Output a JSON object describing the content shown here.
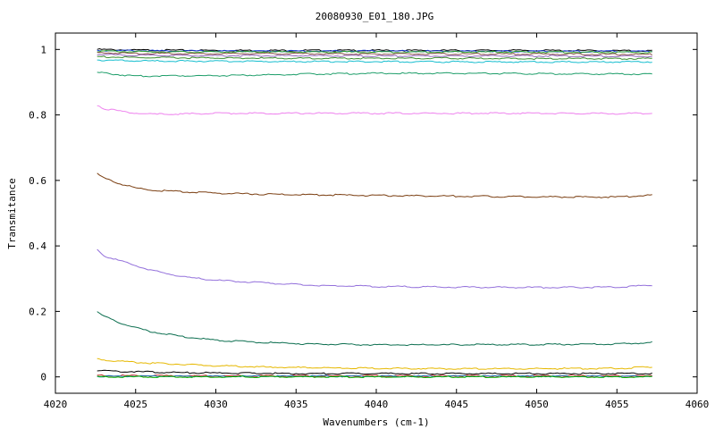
{
  "chart_data": {
    "type": "line",
    "title": "20080930_E01_180.JPG",
    "xlabel": "Wavenumbers (cm-1)",
    "ylabel": "Transmitance",
    "xlim": [
      4020,
      4060
    ],
    "ylim": [
      -0.05,
      1.05
    ],
    "x_ticks": [
      4020,
      4025,
      4030,
      4035,
      4040,
      4045,
      4050,
      4055,
      4060
    ],
    "x_tick_labels": [
      "4020",
      "4025",
      "4030",
      "4035",
      "4040",
      "4045",
      "4050",
      "4055",
      "4060"
    ],
    "y_ticks": [
      0,
      0.2,
      0.4,
      0.6,
      0.8,
      1
    ],
    "y_tick_labels": [
      "0",
      "0.2",
      "0.4",
      "0.6",
      "0.8",
      "1"
    ],
    "grid": false,
    "legend": "none",
    "x_range_of_data": [
      4022.6,
      4057.2
    ],
    "series": [
      {
        "color": "#000000",
        "x": [
          4022.6,
          4025,
          4030,
          4035,
          4040,
          4045,
          4050,
          4055,
          4057.2
        ],
        "y": [
          1.0,
          0.998,
          0.997,
          0.997,
          0.997,
          0.997,
          0.997,
          0.996,
          0.996
        ]
      },
      {
        "color": "#1a3fd6",
        "x": [
          4022.6,
          4025,
          4030,
          4035,
          4040,
          4045,
          4050,
          4055,
          4057.2
        ],
        "y": [
          0.997,
          0.996,
          0.995,
          0.995,
          0.995,
          0.995,
          0.994,
          0.994,
          0.994
        ]
      },
      {
        "color": "#2ca02c",
        "x": [
          4022.6,
          4025,
          4030,
          4035,
          4040,
          4045,
          4050,
          4055,
          4057.2
        ],
        "y": [
          0.995,
          0.993,
          0.992,
          0.992,
          0.992,
          0.992,
          0.992,
          0.991,
          0.991
        ]
      },
      {
        "color": "#8c564b",
        "x": [
          4022.6,
          4025,
          4030,
          4035,
          4040,
          4045,
          4050,
          4055,
          4057.2
        ],
        "y": [
          0.99,
          0.988,
          0.987,
          0.987,
          0.986,
          0.986,
          0.986,
          0.985,
          0.985
        ]
      },
      {
        "color": "#9467bd",
        "x": [
          4022.6,
          4025,
          4030,
          4035,
          4040,
          4045,
          4050,
          4055,
          4057.2
        ],
        "y": [
          0.985,
          0.982,
          0.981,
          0.981,
          0.98,
          0.98,
          0.98,
          0.979,
          0.979
        ]
      },
      {
        "color": "#3d8f2f",
        "x": [
          4022.6,
          4025,
          4030,
          4035,
          4040,
          4045,
          4050,
          4055,
          4057.2
        ],
        "y": [
          0.978,
          0.975,
          0.974,
          0.973,
          0.973,
          0.973,
          0.972,
          0.972,
          0.972
        ]
      },
      {
        "color": "#17becf",
        "x": [
          4022.6,
          4025,
          4030,
          4035,
          4040,
          4045,
          4050,
          4055,
          4057.2
        ],
        "y": [
          0.968,
          0.965,
          0.964,
          0.963,
          0.963,
          0.962,
          0.962,
          0.962,
          0.962
        ]
      },
      {
        "color": "#1e9e6a",
        "x": [
          4022.6,
          4023.5,
          4025,
          4027,
          4030,
          4033,
          4036,
          4040,
          4045,
          4050,
          4055,
          4057.2
        ],
        "y": [
          0.93,
          0.925,
          0.918,
          0.92,
          0.92,
          0.922,
          0.925,
          0.927,
          0.927,
          0.926,
          0.925,
          0.925
        ]
      },
      {
        "color": "#ee82ee",
        "x": [
          4022.6,
          4023,
          4024,
          4025,
          4026,
          4028,
          4030,
          4033,
          4036,
          4040,
          4045,
          4050,
          4055,
          4057.2
        ],
        "y": [
          0.83,
          0.82,
          0.812,
          0.805,
          0.802,
          0.803,
          0.805,
          0.805,
          0.805,
          0.805,
          0.805,
          0.805,
          0.804,
          0.805
        ]
      },
      {
        "color": "#7b3f12",
        "x": [
          4022.6,
          4023,
          4024,
          4025,
          4026,
          4028,
          4030,
          4033,
          4036,
          4040,
          4045,
          4050,
          4055,
          4057.2
        ],
        "y": [
          0.62,
          0.608,
          0.59,
          0.577,
          0.57,
          0.565,
          0.561,
          0.558,
          0.556,
          0.554,
          0.552,
          0.55,
          0.549,
          0.555
        ]
      },
      {
        "color": "#9370db",
        "x": [
          4022.6,
          4023,
          4024,
          4025,
          4026,
          4028,
          4030,
          4033,
          4036,
          4040,
          4045,
          4050,
          4055,
          4057.2
        ],
        "y": [
          0.39,
          0.37,
          0.355,
          0.34,
          0.325,
          0.305,
          0.295,
          0.287,
          0.28,
          0.276,
          0.274,
          0.273,
          0.274,
          0.28
        ]
      },
      {
        "color": "#0b6e4f",
        "x": [
          4022.6,
          4023,
          4024,
          4025,
          4026,
          4028,
          4030,
          4033,
          4036,
          4040,
          4045,
          4050,
          4055,
          4057.2
        ],
        "y": [
          0.2,
          0.185,
          0.165,
          0.15,
          0.138,
          0.122,
          0.112,
          0.105,
          0.1,
          0.098,
          0.098,
          0.099,
          0.1,
          0.105
        ]
      },
      {
        "color": "#e6b800",
        "x": [
          4022.6,
          4023,
          4024,
          4025,
          4026,
          4028,
          4030,
          4033,
          4036,
          4040,
          4045,
          4050,
          4055,
          4057.2
        ],
        "y": [
          0.055,
          0.052,
          0.048,
          0.045,
          0.042,
          0.038,
          0.034,
          0.03,
          0.028,
          0.026,
          0.025,
          0.025,
          0.026,
          0.03
        ]
      },
      {
        "color": "#000000",
        "x": [
          4022.6,
          4024,
          4026,
          4028,
          4030,
          4033,
          4036,
          4040,
          4045,
          4050,
          4055,
          4057.2
        ],
        "y": [
          0.02,
          0.017,
          0.015,
          0.013,
          0.012,
          0.011,
          0.01,
          0.01,
          0.01,
          0.01,
          0.01,
          0.01
        ]
      },
      {
        "color": "#cc3333",
        "x": [
          4022.6,
          4025,
          4030,
          4035,
          4040,
          4045,
          4050,
          4055,
          4057.2
        ],
        "y": [
          0.004,
          0.004,
          0.003,
          0.003,
          0.003,
          0.003,
          0.003,
          0.003,
          0.003
        ]
      },
      {
        "color": "#1f77b4",
        "x": [
          4022.6,
          4025,
          4030,
          4035,
          4040,
          4045,
          4050,
          4055,
          4057.2
        ],
        "y": [
          0.002,
          0.002,
          0.002,
          0.002,
          0.002,
          0.002,
          0.002,
          0.002,
          0.002
        ]
      },
      {
        "color": "#00b300",
        "x": [
          4022.6,
          4025,
          4030,
          4035,
          4040,
          4045,
          4050,
          4055,
          4057.2
        ],
        "y": [
          0.0,
          0.0,
          0.0,
          0.0,
          0.0,
          0.0,
          0.0,
          0.0,
          0.0
        ]
      }
    ]
  }
}
